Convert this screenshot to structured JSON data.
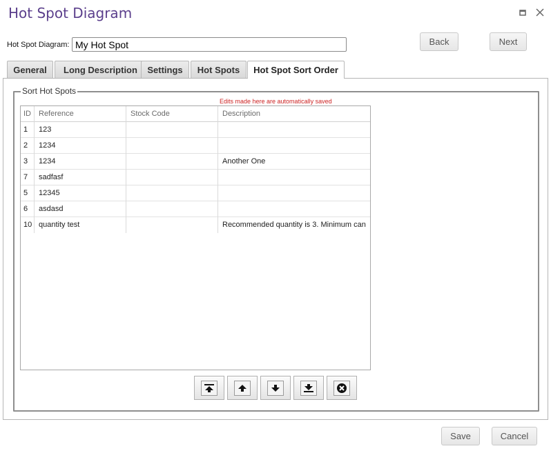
{
  "window": {
    "title": "Hot Spot Diagram"
  },
  "form": {
    "name_label": "Hot Spot Diagram:",
    "name_value": "My Hot Spot"
  },
  "nav": {
    "back_label": "Back",
    "next_label": "Next"
  },
  "tabs": [
    {
      "label": "General"
    },
    {
      "label": "Long Description"
    },
    {
      "label": "Settings"
    },
    {
      "label": "Hot Spots"
    },
    {
      "label": "Hot Spot Sort Order"
    }
  ],
  "active_tab": "Hot Spot Sort Order",
  "sort_section": {
    "legend": "Sort Hot Spots",
    "autosave_note": "Edits made here are automatically saved",
    "columns": [
      "ID",
      "Reference",
      "Stock Code",
      "Description"
    ],
    "rows": [
      [
        "1",
        "123",
        "",
        ""
      ],
      [
        "2",
        "1234",
        "",
        ""
      ],
      [
        "3",
        "1234",
        "",
        "Another One"
      ],
      [
        "7",
        "sadfasf",
        "",
        ""
      ],
      [
        "5",
        "12345",
        "",
        ""
      ],
      [
        "6",
        "asdasd",
        "",
        ""
      ],
      [
        "10",
        "quantity test",
        "",
        "Recommended quantity is 3.  Minimum can"
      ]
    ],
    "sort_buttons": [
      {
        "icon": "move-to-top-icon"
      },
      {
        "icon": "move-up-icon"
      },
      {
        "icon": "move-down-icon"
      },
      {
        "icon": "move-to-bottom-icon"
      },
      {
        "icon": "remove-icon"
      }
    ]
  },
  "footer": {
    "save_label": "Save",
    "cancel_label": "Cancel"
  },
  "colors": {
    "title": "#5b3f8c",
    "note": "#cc2222"
  }
}
